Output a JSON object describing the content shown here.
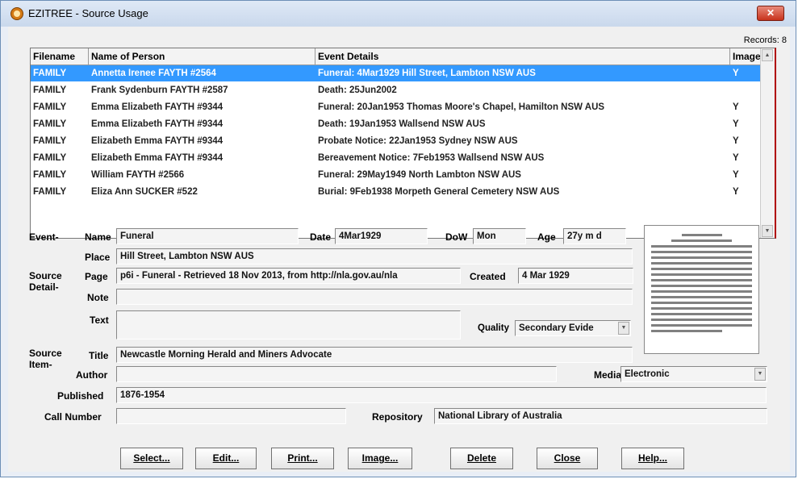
{
  "window": {
    "title": "EZITREE - Source Usage",
    "close_glyph": "✕"
  },
  "records": "Records: 8",
  "grid": {
    "columns": [
      "Filename",
      "Name of Person",
      "Event Details",
      "Image"
    ],
    "rows": [
      {
        "file": "FAMILY",
        "person": "Annetta Irenee FAYTH  #2564",
        "event": "Funeral: 4Mar1929 Hill Street, Lambton NSW AUS",
        "image": "Y"
      },
      {
        "file": "FAMILY",
        "person": "Frank Sydenburn FAYTH  #2587",
        "event": "Death: 25Jun2002",
        "image": ""
      },
      {
        "file": "FAMILY",
        "person": "Emma Elizabeth FAYTH  #9344",
        "event": "Funeral: 20Jan1953 Thomas Moore's Chapel, Hamilton NSW AUS",
        "image": "Y"
      },
      {
        "file": "FAMILY",
        "person": "Emma Elizabeth FAYTH  #9344",
        "event": "Death: 19Jan1953 Wallsend NSW AUS",
        "image": "Y"
      },
      {
        "file": "FAMILY",
        "person": "Elizabeth Emma FAYTH  #9344",
        "event": "Probate Notice: 22Jan1953 Sydney NSW AUS",
        "image": "Y"
      },
      {
        "file": "FAMILY",
        "person": "Elizabeth Emma FAYTH  #9344",
        "event": "Bereavement Notice: 7Feb1953 Wallsend NSW AUS",
        "image": "Y"
      },
      {
        "file": "FAMILY",
        "person": "William FAYTH  #2566",
        "event": "Funeral: 29May1949 North Lambton NSW AUS",
        "image": "Y"
      },
      {
        "file": "FAMILY",
        "person": "Eliza Ann SUCKER  #522",
        "event": "Burial: 9Feb1938 Morpeth General Cemetery NSW AUS",
        "image": "Y"
      }
    ]
  },
  "labels": {
    "event": "Event-",
    "name": "Name",
    "date": "Date",
    "dow": "DoW",
    "age": "Age",
    "place": "Place",
    "source_detail_1": "Source",
    "source_detail_2": "Detail-",
    "page": "Page",
    "created": "Created",
    "note": "Note",
    "text": "Text",
    "quality": "Quality",
    "source_item_1": "Source",
    "source_item_2": "Item-",
    "title": "Title",
    "author": "Author",
    "media": "Media",
    "published": "Published",
    "call_number": "Call Number",
    "repository": "Repository"
  },
  "fields": {
    "name": "Funeral",
    "date": "4Mar1929",
    "dow": "Mon",
    "age": "27y  m  d",
    "place": "Hill Street, Lambton NSW AUS",
    "page": "p6i - Funeral - Retrieved 18 Nov 2013, from http://nla.gov.au/nla",
    "created": "4 Mar 1929",
    "note": "",
    "text": "",
    "quality": "Secondary Evide",
    "title": "Newcastle Morning Herald and Miners Advocate",
    "author": "",
    "media": "Electronic",
    "published": "1876-1954",
    "call_number": "",
    "repository": "National Library of Australia"
  },
  "buttons": {
    "select": "Select...",
    "edit": "Edit...",
    "print": "Print...",
    "image": "Image...",
    "delete": "Delete",
    "close": "Close",
    "help": "Help..."
  },
  "colors": {
    "selection": "#3399ff",
    "grid_border": "#b00000"
  }
}
